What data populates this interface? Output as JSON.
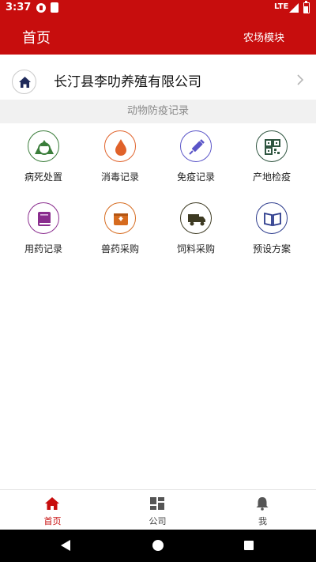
{
  "status_bar": {
    "time": "3:37",
    "network": "LTE"
  },
  "header": {
    "title": "首页",
    "module": "农场模块"
  },
  "company": {
    "name": "长汀县李叻养殖有限公司"
  },
  "section": {
    "title": "动物防疫记录"
  },
  "grid_items": [
    {
      "label": "病死处置",
      "icon": "recycle-icon",
      "color": "#3a7d3a"
    },
    {
      "label": "消毒记录",
      "icon": "droplet-icon",
      "color": "#e0622a"
    },
    {
      "label": "免疫记录",
      "icon": "syringe-icon",
      "color": "#5a55c8"
    },
    {
      "label": "产地检疫",
      "icon": "qr-code-icon",
      "color": "#2f5540"
    },
    {
      "label": "用药记录",
      "icon": "book-icon",
      "color": "#8a2d8e"
    },
    {
      "label": "兽药采购",
      "icon": "inbox-icon",
      "color": "#d66b1f"
    },
    {
      "label": "饲料采购",
      "icon": "truck-icon",
      "color": "#3d3a22"
    },
    {
      "label": "预设方案",
      "icon": "open-book-icon",
      "color": "#2c3b8c"
    }
  ],
  "bottom_nav": [
    {
      "label": "首页",
      "icon": "home-icon",
      "active": true
    },
    {
      "label": "公司",
      "icon": "dashboard-icon",
      "active": false
    },
    {
      "label": "我",
      "icon": "bell-icon",
      "active": false
    }
  ],
  "colors": {
    "brand": "#c70d0d",
    "section_bg": "#f1f1f1"
  }
}
